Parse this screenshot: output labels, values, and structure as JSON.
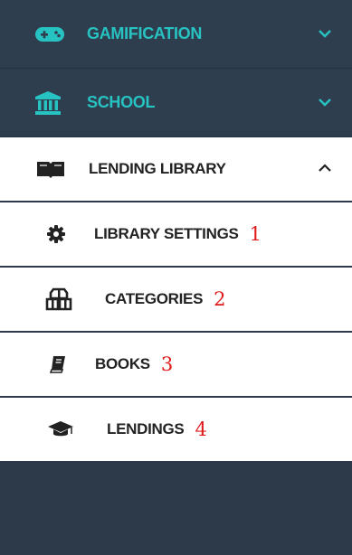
{
  "colors": {
    "dark_bg": "#2f3e4e",
    "accent": "#27c2c2",
    "annotation": "#e0191b"
  },
  "menu": {
    "gamification": {
      "label": "GAMIFICATION",
      "icon": "gamepad-icon",
      "state": "collapsed"
    },
    "school": {
      "label": "SCHOOL",
      "icon": "bank-icon",
      "state": "collapsed"
    },
    "lending_library": {
      "label": "LENDING LIBRARY",
      "icon": "open-book-icon",
      "state": "expanded"
    },
    "submenu": [
      {
        "label": "LIBRARY SETTINGS",
        "icon": "gear-icon",
        "annotation": "1"
      },
      {
        "label": "CATEGORIES",
        "icon": "cubes-icon",
        "annotation": "2"
      },
      {
        "label": "BOOKS",
        "icon": "book-icon",
        "annotation": "3"
      },
      {
        "label": "LENDINGS",
        "icon": "graduation-cap-icon",
        "annotation": "4"
      }
    ]
  }
}
